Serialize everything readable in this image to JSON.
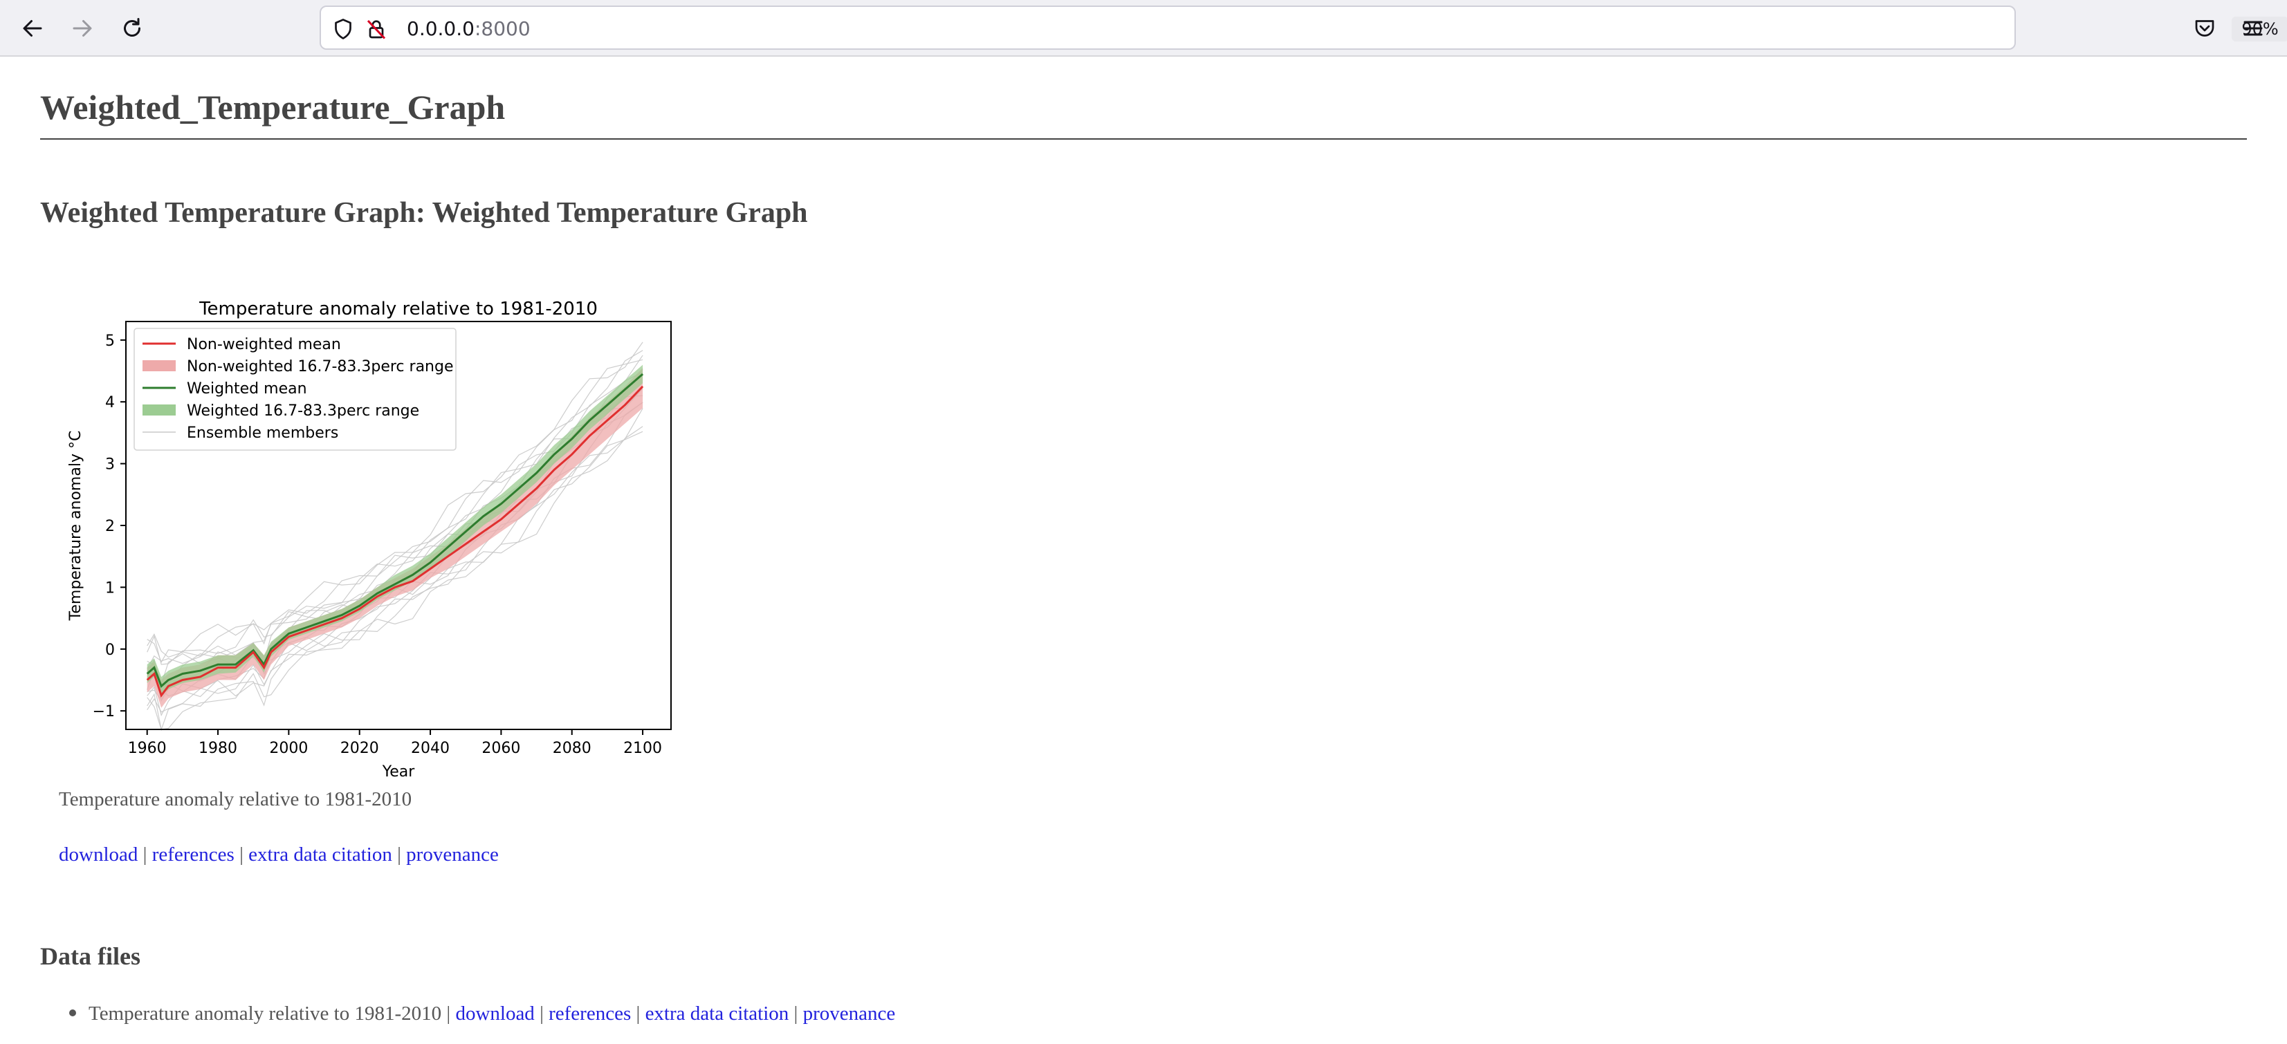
{
  "browser": {
    "url_host": "0.0.0.0",
    "url_port": ":8000",
    "zoom": "90%"
  },
  "page": {
    "title": "Weighted_Temperature_Graph",
    "section_title": "Weighted Temperature Graph: Weighted Temperature Graph",
    "caption": "Temperature anomaly relative to 1981-2010",
    "links": [
      "download",
      "references",
      "extra data citation",
      "provenance"
    ],
    "data_files_title": "Data files",
    "data_files": [
      {
        "label": "Temperature anomaly relative to 1981-2010",
        "links": [
          "download",
          "references",
          "extra data citation",
          "provenance"
        ]
      }
    ]
  },
  "colors": {
    "link": "#2222dd",
    "nonweighted": "#e03030",
    "nonweighted_band": "#eeaaaa",
    "weighted": "#2e7d2e",
    "weighted_band": "#9ccc92",
    "members": "#c8c8c8"
  },
  "chart_data": {
    "type": "line",
    "title": "Temperature anomaly relative to 1981-2010",
    "xlabel": "Year",
    "ylabel": "Temperature anomaly °C",
    "xlim": [
      1954,
      2108
    ],
    "ylim": [
      -1.3,
      5.3
    ],
    "xticks": [
      1960,
      1980,
      2000,
      2020,
      2040,
      2060,
      2080,
      2100
    ],
    "yticks": [
      -1,
      0,
      1,
      2,
      3,
      4,
      5
    ],
    "legend_position": "upper-left",
    "x": [
      1960,
      1962,
      1964,
      1966,
      1970,
      1975,
      1980,
      1985,
      1990,
      1993,
      1995,
      2000,
      2005,
      2010,
      2015,
      2020,
      2025,
      2030,
      2035,
      2040,
      2045,
      2050,
      2055,
      2060,
      2065,
      2070,
      2075,
      2080,
      2085,
      2090,
      2095,
      2100
    ],
    "series": [
      {
        "name": "Non-weighted mean",
        "kind": "line",
        "values": [
          -0.5,
          -0.4,
          -0.75,
          -0.6,
          -0.5,
          -0.45,
          -0.3,
          -0.3,
          -0.05,
          -0.3,
          -0.05,
          0.2,
          0.3,
          0.4,
          0.5,
          0.65,
          0.85,
          1.0,
          1.1,
          1.3,
          1.5,
          1.7,
          1.9,
          2.1,
          2.35,
          2.6,
          2.9,
          3.15,
          3.45,
          3.7,
          3.95,
          4.25
        ]
      },
      {
        "name": "Non-weighted 16.7-83.3perc range",
        "kind": "band",
        "lower": [
          -0.7,
          -0.6,
          -0.95,
          -0.8,
          -0.7,
          -0.65,
          -0.5,
          -0.5,
          -0.25,
          -0.5,
          -0.25,
          0.05,
          0.15,
          0.25,
          0.35,
          0.5,
          0.7,
          0.85,
          0.95,
          1.15,
          1.3,
          1.5,
          1.7,
          1.9,
          2.1,
          2.35,
          2.65,
          2.9,
          3.15,
          3.4,
          3.65,
          3.9
        ],
        "upper": [
          -0.3,
          -0.2,
          -0.5,
          -0.4,
          -0.3,
          -0.25,
          -0.1,
          -0.1,
          0.1,
          -0.1,
          0.1,
          0.35,
          0.45,
          0.55,
          0.65,
          0.8,
          1.0,
          1.15,
          1.3,
          1.5,
          1.7,
          1.95,
          2.15,
          2.35,
          2.6,
          2.85,
          3.15,
          3.45,
          3.75,
          4.0,
          4.25,
          4.55
        ]
      },
      {
        "name": "Weighted mean",
        "kind": "line",
        "values": [
          -0.4,
          -0.3,
          -0.6,
          -0.5,
          -0.4,
          -0.35,
          -0.25,
          -0.25,
          -0.02,
          -0.25,
          0.0,
          0.25,
          0.35,
          0.45,
          0.55,
          0.7,
          0.9,
          1.05,
          1.2,
          1.4,
          1.65,
          1.9,
          2.15,
          2.35,
          2.6,
          2.85,
          3.15,
          3.4,
          3.7,
          3.95,
          4.2,
          4.45
        ]
      },
      {
        "name": "Weighted 16.7-83.3perc range",
        "kind": "band",
        "lower": [
          -0.55,
          -0.45,
          -0.75,
          -0.65,
          -0.55,
          -0.5,
          -0.4,
          -0.38,
          -0.12,
          -0.38,
          -0.12,
          0.15,
          0.25,
          0.35,
          0.45,
          0.6,
          0.8,
          0.95,
          1.1,
          1.3,
          1.5,
          1.75,
          2.0,
          2.2,
          2.45,
          2.7,
          3.0,
          3.25,
          3.55,
          3.8,
          4.05,
          4.3
        ],
        "upper": [
          -0.25,
          -0.15,
          -0.45,
          -0.35,
          -0.25,
          -0.2,
          -0.1,
          -0.1,
          0.1,
          -0.1,
          0.12,
          0.35,
          0.45,
          0.55,
          0.65,
          0.8,
          1.0,
          1.2,
          1.35,
          1.55,
          1.8,
          2.05,
          2.3,
          2.5,
          2.75,
          3.0,
          3.3,
          3.55,
          3.85,
          4.1,
          4.35,
          4.6
        ]
      },
      {
        "name": "Ensemble members",
        "kind": "lines",
        "note_levels": "members approx between band lower-0.3 and upper+0.35"
      }
    ]
  }
}
